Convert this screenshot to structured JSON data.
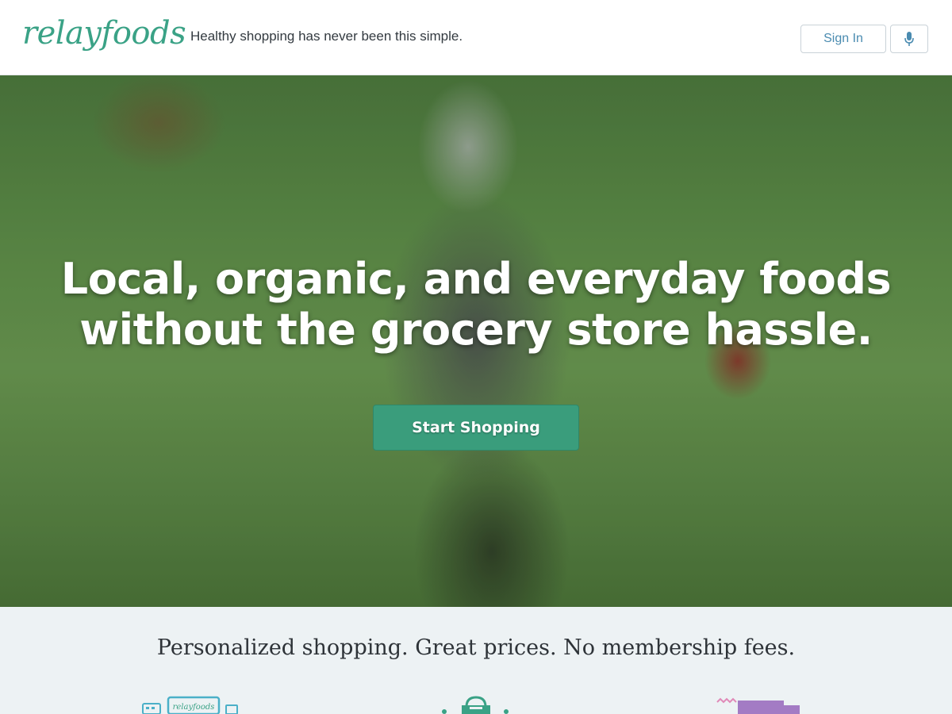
{
  "header": {
    "logo": "relayfoods",
    "tagline": "Healthy shopping has never been this simple.",
    "signin_label": "Sign In",
    "mic_icon": "microphone-icon"
  },
  "hero": {
    "headline_line1": "Local, organic, and everyday foods",
    "headline_line2": "without the grocery store hassle.",
    "cta_label": "Start Shopping"
  },
  "features": {
    "tagline": "Personalized shopping. Great prices. No membership fees.",
    "icons": [
      "devices-icon",
      "basket-icon",
      "delivery-truck-icon"
    ],
    "device_logo": "relayfoods"
  },
  "colors": {
    "brand_green": "#3aa286",
    "cta_green": "#3a9d7c",
    "link_blue": "#4a8bb0",
    "features_bg": "#edf2f4",
    "icon_teal": "#4bb0c8",
    "icon_purple": "#a37bc4"
  }
}
